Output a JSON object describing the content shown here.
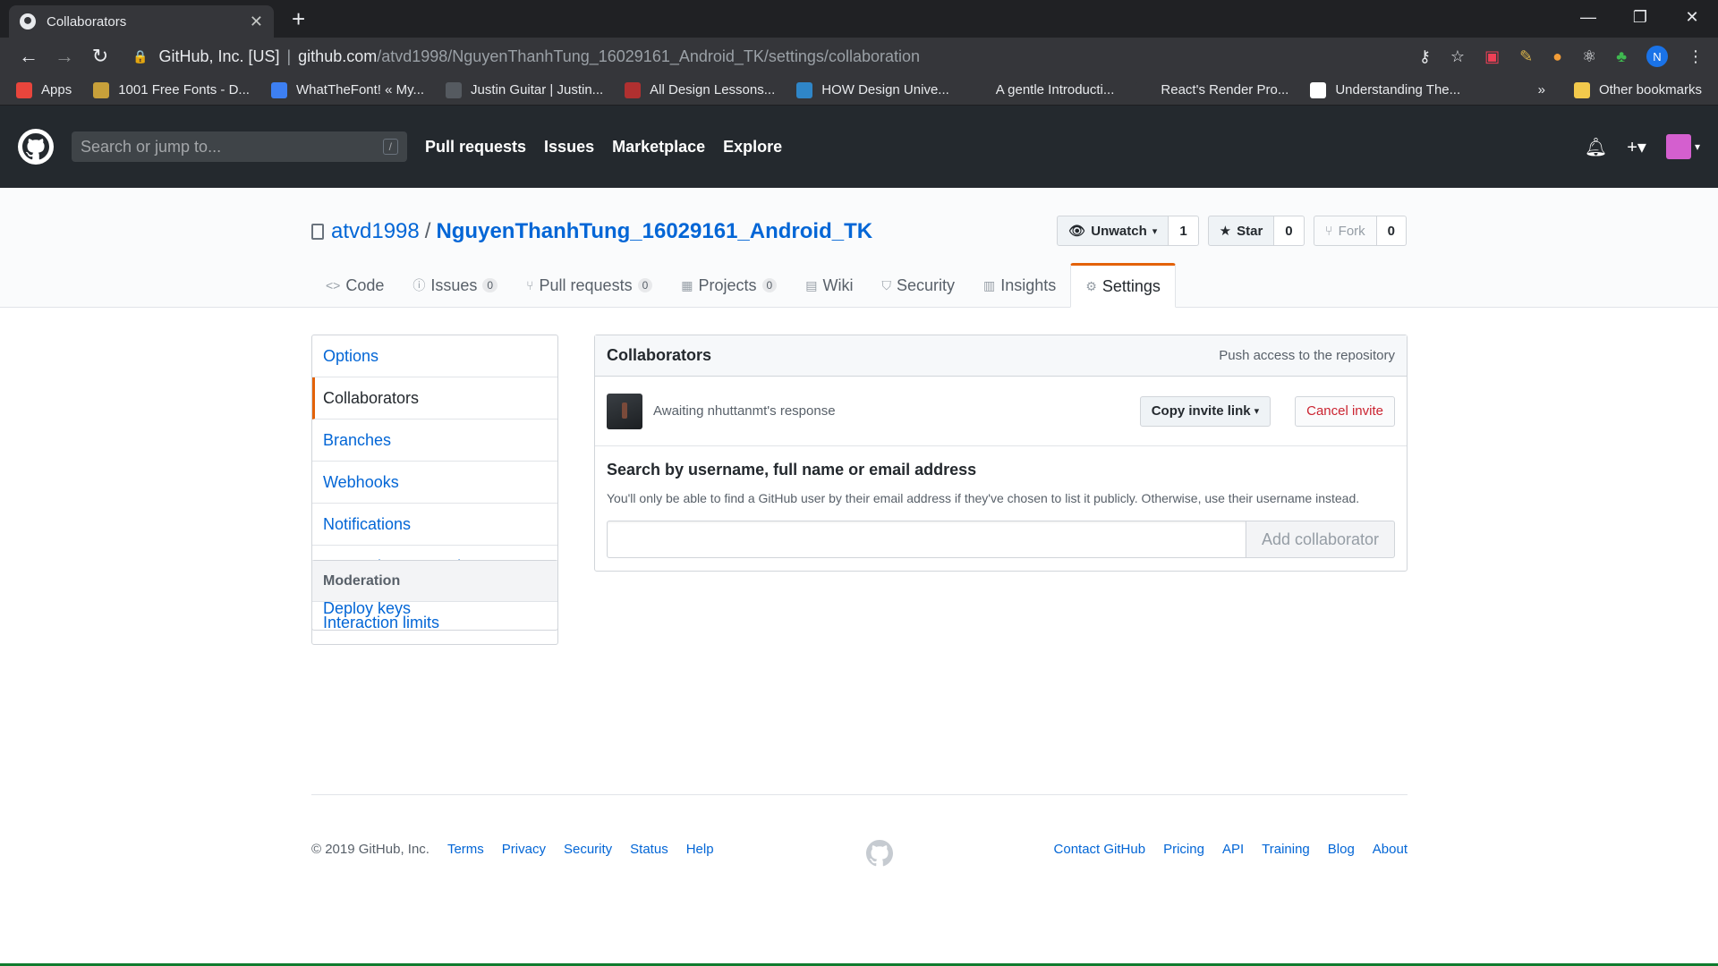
{
  "browser": {
    "tab_title": "Collaborators",
    "url_site": "GitHub, Inc. [US]",
    "url_host": "github.com",
    "url_path": "/atvd1998/NguyenThanhTung_16029161_Android_TK/settings/collaboration",
    "profile_initial": "N",
    "bookmarks": [
      {
        "label": "Apps",
        "color": "#e8453c"
      },
      {
        "label": "1001 Free Fonts - D...",
        "color": "#c8a03a"
      },
      {
        "label": "WhatTheFont! « My...",
        "color": "#3d7ff2"
      },
      {
        "label": "Justin Guitar | Justin...",
        "color": "#555a60"
      },
      {
        "label": "All Design Lessons...",
        "color": "#b03030"
      },
      {
        "label": "HOW Design Unive...",
        "color": "#2f86c8"
      },
      {
        "label": "A gentle Introducti...",
        "color": "#35363a"
      },
      {
        "label": "React's Render Pro...",
        "color": "#35363a"
      },
      {
        "label": "Understanding The...",
        "color": "#ffffff"
      }
    ],
    "bookmarks_overflow": "»",
    "other_bookmarks": "Other bookmarks"
  },
  "gh": {
    "search_placeholder": "Search or jump to...",
    "search_key": "/",
    "nav": [
      "Pull requests",
      "Issues",
      "Marketplace",
      "Explore"
    ]
  },
  "repo": {
    "owner": "atvd1998",
    "sep": "/",
    "name": "NguyenThanhTung_16029161_Android_TK",
    "watch_label": "Unwatch",
    "watch_count": "1",
    "star_label": "Star",
    "star_count": "0",
    "fork_label": "Fork",
    "fork_count": "0",
    "tabs": [
      {
        "label": "Code",
        "icon": "<>",
        "count": ""
      },
      {
        "label": "Issues",
        "icon": "ⓘ",
        "count": "0"
      },
      {
        "label": "Pull requests",
        "icon": "⑂",
        "count": "0"
      },
      {
        "label": "Projects",
        "icon": "▦",
        "count": "0"
      },
      {
        "label": "Wiki",
        "icon": "▤",
        "count": ""
      },
      {
        "label": "Security",
        "icon": "⛉",
        "count": ""
      },
      {
        "label": "Insights",
        "icon": "▥",
        "count": ""
      },
      {
        "label": "Settings",
        "icon": "⚙",
        "count": ""
      }
    ]
  },
  "sidebar": {
    "items": [
      "Options",
      "Collaborators",
      "Branches",
      "Webhooks",
      "Notifications",
      "Integrations & services",
      "Deploy keys"
    ],
    "moderation_title": "Moderation",
    "moderation_items": [
      "Interaction limits"
    ]
  },
  "collaborators": {
    "title": "Collaborators",
    "subtitle": "Push access to the repository",
    "awaiting": "Awaiting nhuttanmt's response",
    "copy_invite": "Copy invite link",
    "cancel_invite": "Cancel invite",
    "search_title": "Search by username, full name or email address",
    "search_help": "You'll only be able to find a GitHub user by their email address if they've chosen to list it publicly. Otherwise, use their username instead.",
    "add_button": "Add collaborator"
  },
  "footer": {
    "copyright": "© 2019 GitHub, Inc.",
    "left_links": [
      "Terms",
      "Privacy",
      "Security",
      "Status",
      "Help"
    ],
    "right_links": [
      "Contact GitHub",
      "Pricing",
      "API",
      "Training",
      "Blog",
      "About"
    ]
  }
}
